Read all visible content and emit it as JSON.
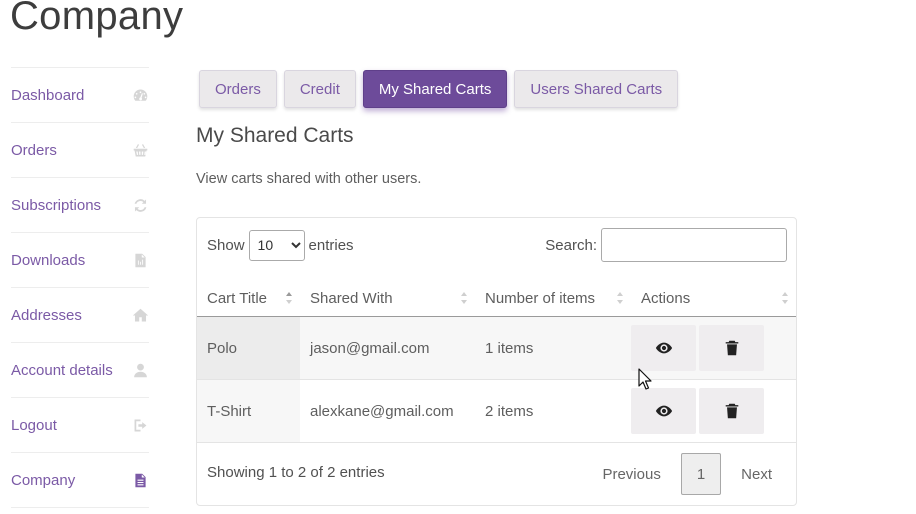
{
  "page": {
    "title": "Company"
  },
  "sidebar": {
    "items": [
      {
        "label": "Dashboard",
        "icon": "dashboard-icon"
      },
      {
        "label": "Orders",
        "icon": "basket-icon"
      },
      {
        "label": "Subscriptions",
        "icon": "refresh-icon"
      },
      {
        "label": "Downloads",
        "icon": "file-icon"
      },
      {
        "label": "Addresses",
        "icon": "home-icon"
      },
      {
        "label": "Account details",
        "icon": "user-icon"
      },
      {
        "label": "Logout",
        "icon": "sign-out-icon"
      },
      {
        "label": "Company",
        "icon": "document-icon",
        "active": true
      }
    ]
  },
  "tabs": [
    {
      "label": "Orders"
    },
    {
      "label": "Credit"
    },
    {
      "label": "My Shared Carts",
      "active": true
    },
    {
      "label": "Users Shared Carts"
    }
  ],
  "section": {
    "title": "My Shared Carts",
    "description": "View carts shared with other users."
  },
  "table": {
    "length": {
      "show_label": "Show",
      "entries_label": "entries",
      "selected": "10"
    },
    "search": {
      "label": "Search:",
      "value": ""
    },
    "columns": [
      "Cart Title",
      "Shared With",
      "Number of items",
      "Actions"
    ],
    "rows": [
      {
        "title": "Polo",
        "shared_with": "jason@gmail.com",
        "items": "1 items"
      },
      {
        "title": "T-Shirt",
        "shared_with": "alexkane@gmail.com",
        "items": "2 items"
      }
    ],
    "info": "Showing 1 to 2 of 2 entries",
    "pagination": {
      "previous": "Previous",
      "current": "1",
      "next": "Next"
    }
  },
  "colors": {
    "accent": "#6d4b9a",
    "link": "#7b5aa6",
    "tab_bg": "#ebe9eb"
  }
}
